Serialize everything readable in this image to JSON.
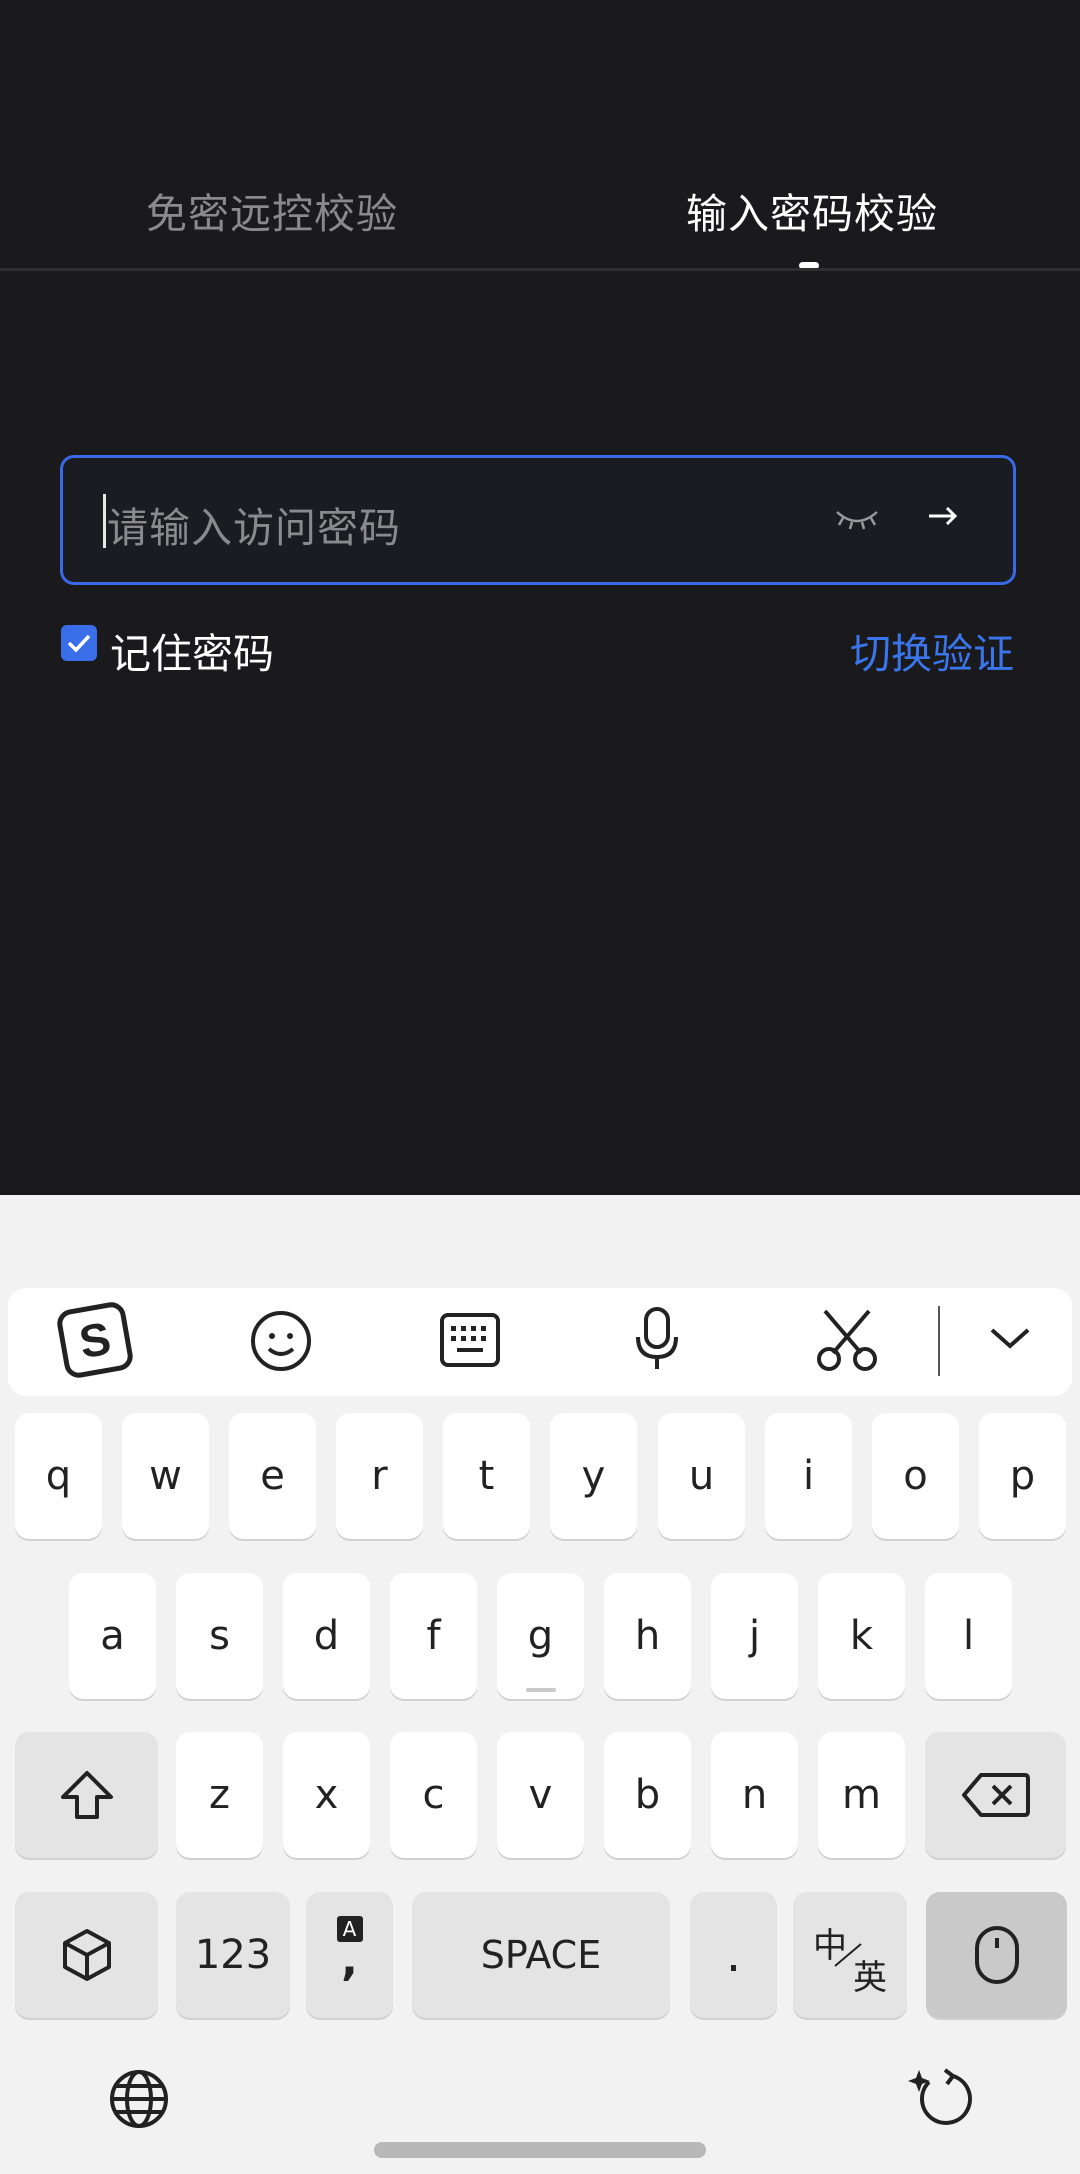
{
  "tabs": [
    {
      "label": "免密远控校验",
      "active": false
    },
    {
      "label": "输入密码校验",
      "active": true
    }
  ],
  "password": {
    "placeholder": "请输入访问密码",
    "value": ""
  },
  "remember": {
    "label": "记住密码",
    "checked": true
  },
  "switch_link": "切换验证",
  "keyboard": {
    "row1": [
      "q",
      "w",
      "e",
      "r",
      "t",
      "y",
      "u",
      "i",
      "o",
      "p"
    ],
    "row2": [
      "a",
      "s",
      "d",
      "f",
      "g",
      "h",
      "j",
      "k",
      "l"
    ],
    "row3": [
      "z",
      "x",
      "c",
      "v",
      "b",
      "n",
      "m"
    ],
    "numbers_label": "123",
    "comma_label": ",",
    "comma_badge": "A",
    "space_label": "SPACE",
    "period_label": ".",
    "lang_top": "中",
    "lang_bottom": "英"
  },
  "icons": {
    "toolbar": [
      "sogou-logo-icon",
      "emoji-icon",
      "keyboard-icon",
      "microphone-icon",
      "scissors-icon",
      "chevron-down-icon"
    ],
    "eye": "eye-closed-icon",
    "arrow": "arrow-right-icon"
  },
  "colors": {
    "accent": "#3a6ee8",
    "link": "#3a75ec",
    "background": "#1a1a1d"
  }
}
